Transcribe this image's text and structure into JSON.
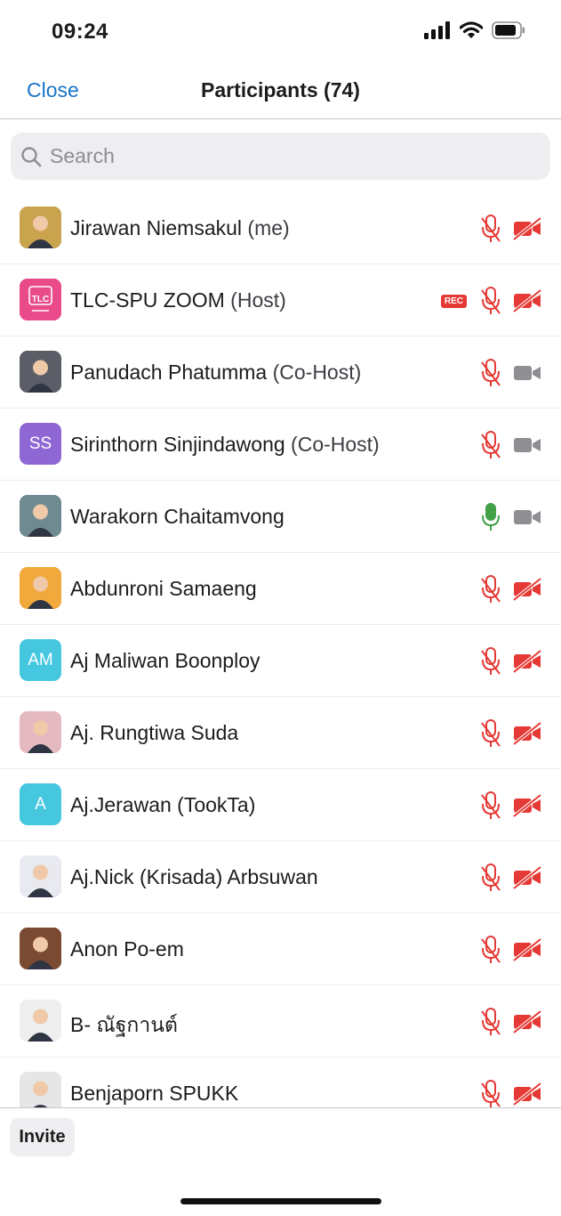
{
  "status_bar": {
    "time": "09:24"
  },
  "header": {
    "close_label": "Close",
    "title": "Participants (74)"
  },
  "search": {
    "placeholder": "Search",
    "value": ""
  },
  "colors": {
    "accent": "#1a73c8",
    "muted": "#e53935",
    "unmuted": "#43a047",
    "camera_on": "#8e8e93"
  },
  "participants": [
    {
      "name": "Jirawan Niemsakul",
      "role": "(me)",
      "avatar": {
        "type": "photo",
        "color": "#c9a34e"
      },
      "recording": false,
      "mic": "muted",
      "video": "off"
    },
    {
      "name": "TLC-SPU ZOOM",
      "role": "(Host)",
      "avatar": {
        "type": "logo",
        "text": "TLC",
        "color": "#e84a8a"
      },
      "recording": true,
      "rec_label": "REC",
      "mic": "muted",
      "video": "off"
    },
    {
      "name": "Panudach Phatumma",
      "role": "(Co-Host)",
      "avatar": {
        "type": "photo",
        "color": "#5b5e66"
      },
      "recording": false,
      "mic": "muted",
      "video": "on"
    },
    {
      "name": "Sirinthorn Sinjindawong",
      "role": "(Co-Host)",
      "avatar": {
        "type": "initials",
        "text": "SS",
        "color": "#8f67d4"
      },
      "recording": false,
      "mic": "muted",
      "video": "on"
    },
    {
      "name": "Warakorn Chaitamvong",
      "role": "",
      "avatar": {
        "type": "photo",
        "color": "#6f8a91"
      },
      "recording": false,
      "mic": "unmuted",
      "video": "on"
    },
    {
      "name": "Abdunroni Samaeng",
      "role": "",
      "avatar": {
        "type": "photo",
        "color": "#f2a93b"
      },
      "recording": false,
      "mic": "muted",
      "video": "off"
    },
    {
      "name": "Aj Maliwan Boonploy",
      "role": "",
      "avatar": {
        "type": "initials",
        "text": "AM",
        "color": "#45c7e0"
      },
      "recording": false,
      "mic": "muted",
      "video": "off"
    },
    {
      "name": "Aj. Rungtiwa Suda",
      "role": "",
      "avatar": {
        "type": "photo",
        "color": "#e5b9c2"
      },
      "recording": false,
      "mic": "muted",
      "video": "off"
    },
    {
      "name": "Aj.Jerawan (TookTa)",
      "role": "",
      "avatar": {
        "type": "initials",
        "text": "A",
        "color": "#45c7e0"
      },
      "recording": false,
      "mic": "muted",
      "video": "off"
    },
    {
      "name": "Aj.Nick (Krisada) Arbsuwan",
      "role": "",
      "avatar": {
        "type": "photo",
        "color": "#e8eaef"
      },
      "recording": false,
      "mic": "muted",
      "video": "off"
    },
    {
      "name": "Anon Po-em",
      "role": "",
      "avatar": {
        "type": "photo",
        "color": "#7a4a32"
      },
      "recording": false,
      "mic": "muted",
      "video": "off"
    },
    {
      "name": "B- ณัฐกานต์",
      "role": "",
      "avatar": {
        "type": "photo",
        "color": "#eeeeee"
      },
      "recording": false,
      "mic": "muted",
      "video": "off"
    },
    {
      "name": "Benjaporn SPUKK",
      "role": "",
      "avatar": {
        "type": "photo",
        "color": "#e6e6e6"
      },
      "recording": false,
      "mic": "muted",
      "video": "off"
    }
  ],
  "footer": {
    "invite_label": "Invite"
  }
}
